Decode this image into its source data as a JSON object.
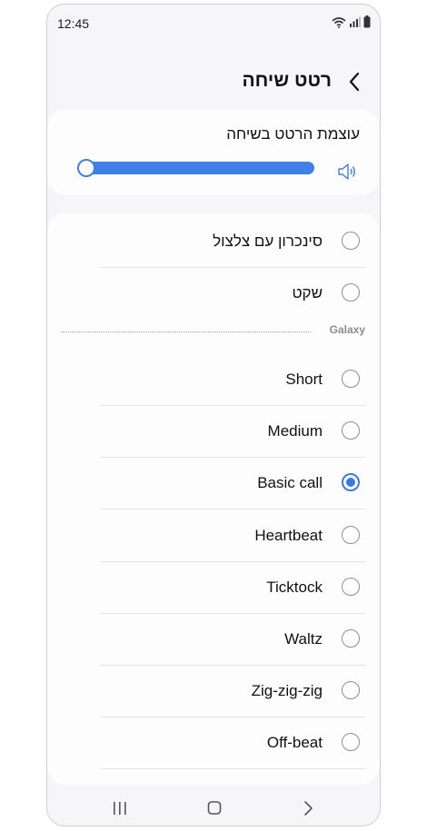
{
  "status_bar": {
    "time": "12:45"
  },
  "header": {
    "title": "רטט שיחה"
  },
  "volume": {
    "label": "עוצמת הרטט בשיחה",
    "level": 0.0
  },
  "options_top": [
    {
      "label": "סינכרון עם צלצול",
      "selected": false
    },
    {
      "label": "שקט",
      "selected": false
    }
  ],
  "section": {
    "title": "Galaxy"
  },
  "options_galaxy": [
    {
      "label": "Short",
      "selected": false
    },
    {
      "label": "Medium",
      "selected": false
    },
    {
      "label": "Basic call",
      "selected": true
    },
    {
      "label": "Heartbeat",
      "selected": false
    },
    {
      "label": "Ticktock",
      "selected": false
    },
    {
      "label": "Waltz",
      "selected": false
    },
    {
      "label": "Zig-zig-zig",
      "selected": false
    },
    {
      "label": "Off-beat",
      "selected": false
    }
  ],
  "colors": {
    "accent": "#3a78e4",
    "background": "#f6f6f8",
    "card": "#fdfdfe"
  }
}
